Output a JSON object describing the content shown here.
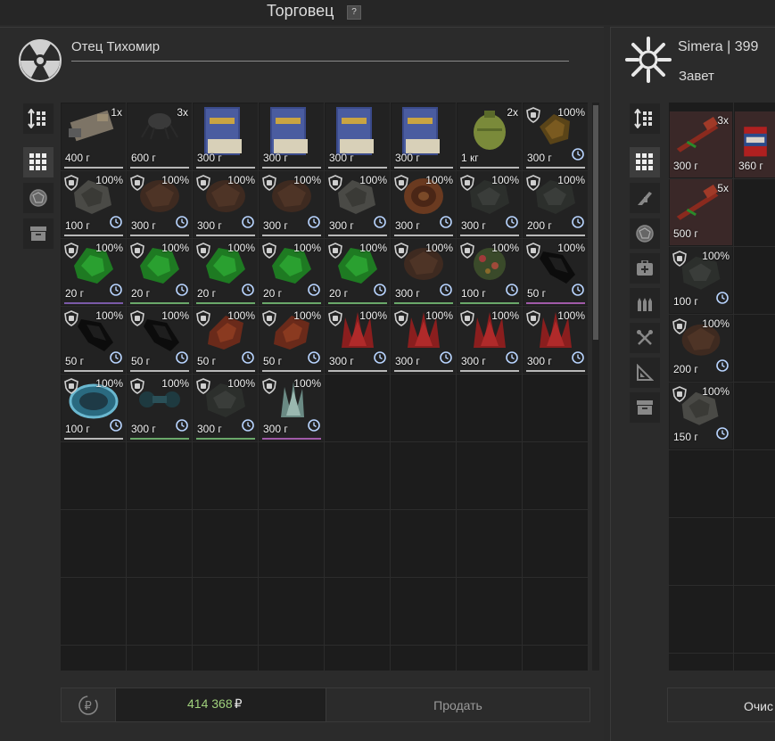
{
  "window": {
    "title": "Торговец",
    "help_label": "?"
  },
  "trader": {
    "name": "Отец Тихомир",
    "emblem_icon": "radiation-icon"
  },
  "player": {
    "name": "Simera | 399",
    "faction": "Завет",
    "emblem_icon": "faction-sun-icon"
  },
  "left_tabs": [
    {
      "icon": "sort-icon",
      "active": false
    },
    {
      "icon": "grid-icon",
      "active": true
    },
    {
      "icon": "artifact-icon",
      "active": false
    },
    {
      "icon": "box-icon",
      "active": false
    }
  ],
  "right_tabs": [
    {
      "icon": "sort-icon",
      "active": false
    },
    {
      "icon": "grid-icon",
      "active": true
    },
    {
      "icon": "rifle-icon",
      "active": false
    },
    {
      "icon": "artifact-icon",
      "active": false
    },
    {
      "icon": "medkit-icon",
      "active": false
    },
    {
      "icon": "ammo-icon",
      "active": false
    },
    {
      "icon": "tools-icon",
      "active": false
    },
    {
      "icon": "ruler-icon",
      "active": false
    },
    {
      "icon": "box-icon",
      "active": false
    }
  ],
  "trader_items": [
    {
      "art": "device",
      "price": "400 г",
      "qty": "1x",
      "cond": "",
      "rule": "#b8b8b8"
    },
    {
      "art": "tick",
      "price": "600 г",
      "qty": "3x",
      "cond": "",
      "rule": "#b8b8b8"
    },
    {
      "art": "book",
      "price": "300 г",
      "qty": "",
      "cond": "",
      "rule": "#b8b8b8"
    },
    {
      "art": "book",
      "price": "300 г",
      "qty": "",
      "cond": "",
      "rule": "#b8b8b8"
    },
    {
      "art": "book",
      "price": "300 г",
      "qty": "",
      "cond": "",
      "rule": "#b8b8b8"
    },
    {
      "art": "book",
      "price": "300 г",
      "qty": "",
      "cond": "",
      "rule": "#b8b8b8"
    },
    {
      "art": "grenade",
      "price": "1 кг",
      "qty": "2x",
      "cond": "",
      "rule": "#b8b8b8"
    },
    {
      "art": "gold",
      "price": "300 г",
      "qty": "",
      "cond": "100%",
      "rule": "#b8b8b8"
    },
    {
      "art": "grey",
      "price": "100 г",
      "qty": "",
      "cond": "100%",
      "rule": "#b8b8b8"
    },
    {
      "art": "brown",
      "price": "300 г",
      "qty": "",
      "cond": "100%",
      "rule": "#b8b8b8"
    },
    {
      "art": "brown",
      "price": "300 г",
      "qty": "",
      "cond": "100%",
      "rule": "#b8b8b8"
    },
    {
      "art": "brown",
      "price": "300 г",
      "qty": "",
      "cond": "100%",
      "rule": "#b8b8b8"
    },
    {
      "art": "grey",
      "price": "300 г",
      "qty": "",
      "cond": "100%",
      "rule": "#b8b8b8"
    },
    {
      "art": "spiral",
      "price": "300 г",
      "qty": "",
      "cond": "100%",
      "rule": "#b8b8b8"
    },
    {
      "art": "dark",
      "price": "300 г",
      "qty": "",
      "cond": "100%",
      "rule": "#b8b8b8"
    },
    {
      "art": "dark",
      "price": "200 г",
      "qty": "",
      "cond": "100%",
      "rule": "#b8b8b8"
    },
    {
      "art": "green",
      "price": "20 г",
      "qty": "",
      "cond": "100%",
      "rule": "#7a5aa8"
    },
    {
      "art": "green",
      "price": "20 г",
      "qty": "",
      "cond": "100%",
      "rule": "#6aa86a"
    },
    {
      "art": "green",
      "price": "20 г",
      "qty": "",
      "cond": "100%",
      "rule": "#6aa86a"
    },
    {
      "art": "green",
      "price": "20 г",
      "qty": "",
      "cond": "100%",
      "rule": "#6aa86a"
    },
    {
      "art": "green",
      "price": "20 г",
      "qty": "",
      "cond": "100%",
      "rule": "#6aa86a"
    },
    {
      "art": "brown",
      "price": "300 г",
      "qty": "",
      "cond": "100%",
      "rule": "#6aa86a"
    },
    {
      "art": "flowers",
      "price": "100 г",
      "qty": "",
      "cond": "100%",
      "rule": "#6aa86a"
    },
    {
      "art": "black",
      "price": "50 г",
      "qty": "",
      "cond": "100%",
      "rule": "#a05aa8"
    },
    {
      "art": "black",
      "price": "50 г",
      "qty": "",
      "cond": "100%",
      "rule": "#b8b8b8"
    },
    {
      "art": "black",
      "price": "50 г",
      "qty": "",
      "cond": "100%",
      "rule": "#b8b8b8"
    },
    {
      "art": "rust",
      "price": "50 г",
      "qty": "",
      "cond": "100%",
      "rule": "#b8b8b8"
    },
    {
      "art": "rust",
      "price": "50 г",
      "qty": "",
      "cond": "100%",
      "rule": "#b8b8b8"
    },
    {
      "art": "red",
      "price": "300 г",
      "qty": "",
      "cond": "100%",
      "rule": "#b8b8b8"
    },
    {
      "art": "red",
      "price": "300 г",
      "qty": "",
      "cond": "100%",
      "rule": "#b8b8b8"
    },
    {
      "art": "red",
      "price": "300 г",
      "qty": "",
      "cond": "100%",
      "rule": "#b8b8b8"
    },
    {
      "art": "red",
      "price": "300 г",
      "qty": "",
      "cond": "100%",
      "rule": "#b8b8b8"
    },
    {
      "art": "cyan",
      "price": "100 г",
      "qty": "",
      "cond": "100%",
      "rule": "#b8b8b8"
    },
    {
      "art": "teal",
      "price": "300 г",
      "qty": "",
      "cond": "100%",
      "rule": "#6aa86a"
    },
    {
      "art": "dark",
      "price": "300 г",
      "qty": "",
      "cond": "100%",
      "rule": "#6aa86a"
    },
    {
      "art": "crystal",
      "price": "300 г",
      "qty": "",
      "cond": "100%",
      "rule": "#a05aa8"
    }
  ],
  "player_items": [
    {
      "art": "injector",
      "price": "300 г",
      "qty": "3x",
      "cond": ""
    },
    {
      "art": "can",
      "price": "360 г",
      "qty": "",
      "cond": ""
    },
    {
      "art": "injector",
      "price": "500 г",
      "qty": "5x",
      "cond": ""
    },
    {
      "art": "dark",
      "price": "100 г",
      "qty": "",
      "cond": "100%"
    },
    {
      "art": "brown",
      "price": "200 г",
      "qty": "",
      "cond": "100%"
    },
    {
      "art": "grey",
      "price": "150 г",
      "qty": "",
      "cond": "100%"
    }
  ],
  "footer": {
    "money": "414 368",
    "currency": "₽",
    "sell_label": "Продать",
    "clear_label": "Очис",
    "rub_icon": "ruble-exchange-icon"
  },
  "colors": {
    "money": "#9fd07c",
    "accent_green": "#6aa86a",
    "accent_purple": "#a05aa8"
  }
}
